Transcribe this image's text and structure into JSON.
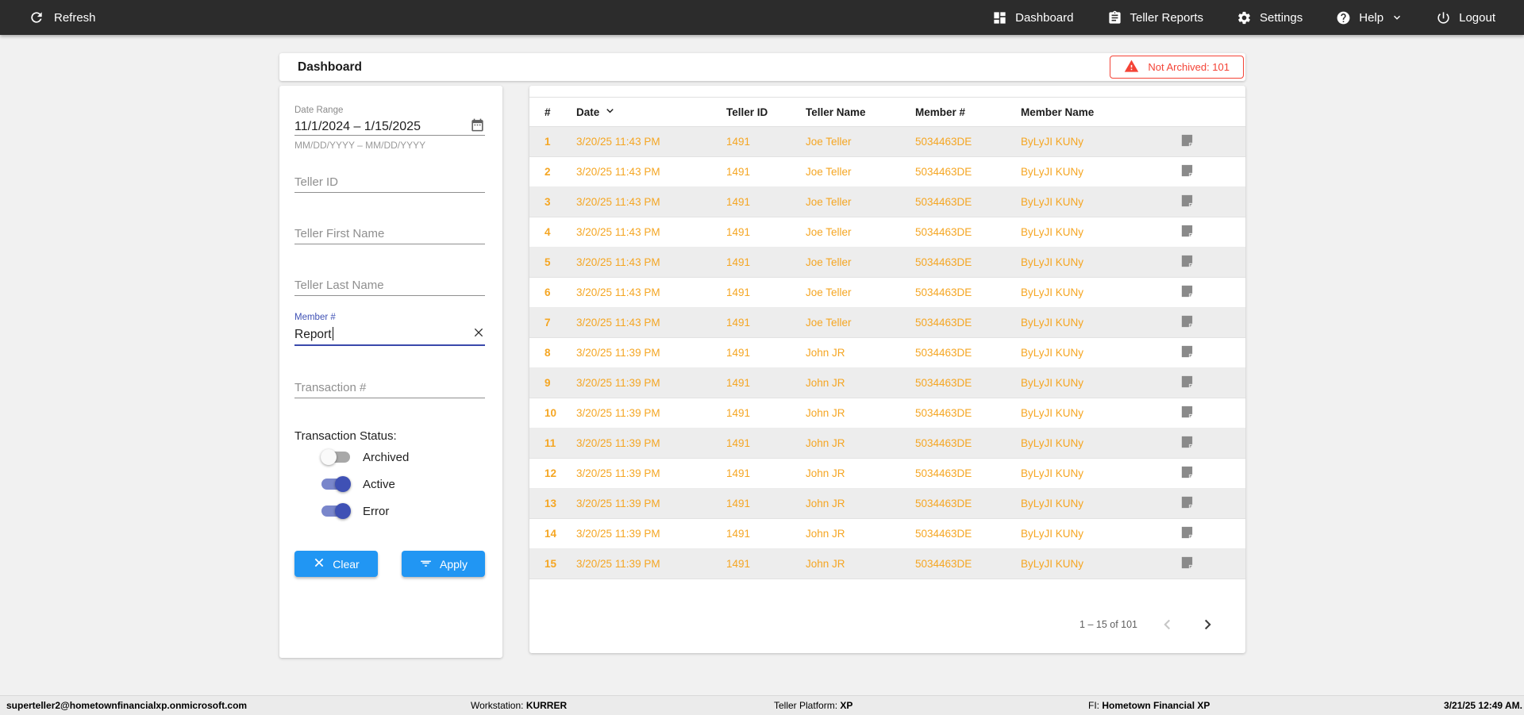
{
  "topbar": {
    "refresh_label": "Refresh",
    "nav": [
      {
        "label": "Dashboard",
        "icon": "dashboard-icon"
      },
      {
        "label": "Teller Reports",
        "icon": "clipboard-icon"
      },
      {
        "label": "Settings",
        "icon": "gear-icon"
      },
      {
        "label": "Help",
        "icon": "help-icon"
      },
      {
        "label": "Logout",
        "icon": "power-icon"
      }
    ]
  },
  "header": {
    "title": "Dashboard",
    "alert": {
      "label": "Not Archived: 101",
      "icon": "warning-icon"
    }
  },
  "filters": {
    "date_range": {
      "label": "Date Range",
      "value": "11/1/2024 – 1/15/2025",
      "hint": "MM/DD/YYYY – MM/DD/YYYY",
      "icon": "calendar-icon"
    },
    "teller_id_placeholder": "Teller ID",
    "teller_first_name_placeholder": "Teller First Name",
    "teller_last_name_placeholder": "Teller Last Name",
    "member": {
      "label": "Member #",
      "value": "Report",
      "clear_icon": "x-icon"
    },
    "transaction_placeholder": "Transaction #",
    "status": {
      "label": "Transaction Status:",
      "toggles": [
        {
          "label": "Archived",
          "on": false
        },
        {
          "label": "Active",
          "on": true
        },
        {
          "label": "Error",
          "on": true
        }
      ]
    },
    "clear_label": "Clear",
    "apply_label": "Apply"
  },
  "table": {
    "columns": [
      "#",
      "Date",
      "Teller ID",
      "Teller Name",
      "Member #",
      "Member Name"
    ],
    "sorted_column": "Date",
    "sort_direction": "desc",
    "rows": [
      {
        "num": "1",
        "date": "3/20/25 11:43 PM",
        "teller_id": "1491",
        "teller_name": "Joe Teller",
        "member_num": "5034463DE",
        "member_name": "ByLyJI KUNy"
      },
      {
        "num": "2",
        "date": "3/20/25 11:43 PM",
        "teller_id": "1491",
        "teller_name": "Joe Teller",
        "member_num": "5034463DE",
        "member_name": "ByLyJI KUNy"
      },
      {
        "num": "3",
        "date": "3/20/25 11:43 PM",
        "teller_id": "1491",
        "teller_name": "Joe Teller",
        "member_num": "5034463DE",
        "member_name": "ByLyJI KUNy"
      },
      {
        "num": "4",
        "date": "3/20/25 11:43 PM",
        "teller_id": "1491",
        "teller_name": "Joe Teller",
        "member_num": "5034463DE",
        "member_name": "ByLyJI KUNy"
      },
      {
        "num": "5",
        "date": "3/20/25 11:43 PM",
        "teller_id": "1491",
        "teller_name": "Joe Teller",
        "member_num": "5034463DE",
        "member_name": "ByLyJI KUNy"
      },
      {
        "num": "6",
        "date": "3/20/25 11:43 PM",
        "teller_id": "1491",
        "teller_name": "Joe Teller",
        "member_num": "5034463DE",
        "member_name": "ByLyJI KUNy"
      },
      {
        "num": "7",
        "date": "3/20/25 11:43 PM",
        "teller_id": "1491",
        "teller_name": "Joe Teller",
        "member_num": "5034463DE",
        "member_name": "ByLyJI KUNy"
      },
      {
        "num": "8",
        "date": "3/20/25 11:39 PM",
        "teller_id": "1491",
        "teller_name": "John JR",
        "member_num": "5034463DE",
        "member_name": "ByLyJI KUNy"
      },
      {
        "num": "9",
        "date": "3/20/25 11:39 PM",
        "teller_id": "1491",
        "teller_name": "John JR",
        "member_num": "5034463DE",
        "member_name": "ByLyJI KUNy"
      },
      {
        "num": "10",
        "date": "3/20/25 11:39 PM",
        "teller_id": "1491",
        "teller_name": "John JR",
        "member_num": "5034463DE",
        "member_name": "ByLyJI KUNy"
      },
      {
        "num": "11",
        "date": "3/20/25 11:39 PM",
        "teller_id": "1491",
        "teller_name": "John JR",
        "member_num": "5034463DE",
        "member_name": "ByLyJI KUNy"
      },
      {
        "num": "12",
        "date": "3/20/25 11:39 PM",
        "teller_id": "1491",
        "teller_name": "John JR",
        "member_num": "5034463DE",
        "member_name": "ByLyJI KUNy"
      },
      {
        "num": "13",
        "date": "3/20/25 11:39 PM",
        "teller_id": "1491",
        "teller_name": "John JR",
        "member_num": "5034463DE",
        "member_name": "ByLyJI KUNy"
      },
      {
        "num": "14",
        "date": "3/20/25 11:39 PM",
        "teller_id": "1491",
        "teller_name": "John JR",
        "member_num": "5034463DE",
        "member_name": "ByLyJI KUNy"
      },
      {
        "num": "15",
        "date": "3/20/25 11:39 PM",
        "teller_id": "1491",
        "teller_name": "John JR",
        "member_num": "5034463DE",
        "member_name": "ByLyJI KUNy"
      }
    ],
    "row_note_icon": "note-icon",
    "pagination": {
      "range_label": "1 – 15 of 101",
      "prev_enabled": false,
      "next_enabled": true
    }
  },
  "statusbar": {
    "user": "superteller2@hometownfinancialxp.onmicrosoft.com",
    "workstation_label": "Workstation: ",
    "workstation": "KURRER",
    "platform_label": "Teller Platform: ",
    "platform": "XP",
    "fi_label": "FI: ",
    "fi": "Hometown Financial XP",
    "datetime": "3/21/25 12:49 AM."
  },
  "colors": {
    "topbar_bg": "#2c2c2c",
    "accent_blue": "#2196f3",
    "indigo": "#3f51b5",
    "indigo_track": "#7986cb",
    "row_orange": "#f5a623",
    "alert_red": "#f44336",
    "page_bg": "#f1f1f1"
  }
}
